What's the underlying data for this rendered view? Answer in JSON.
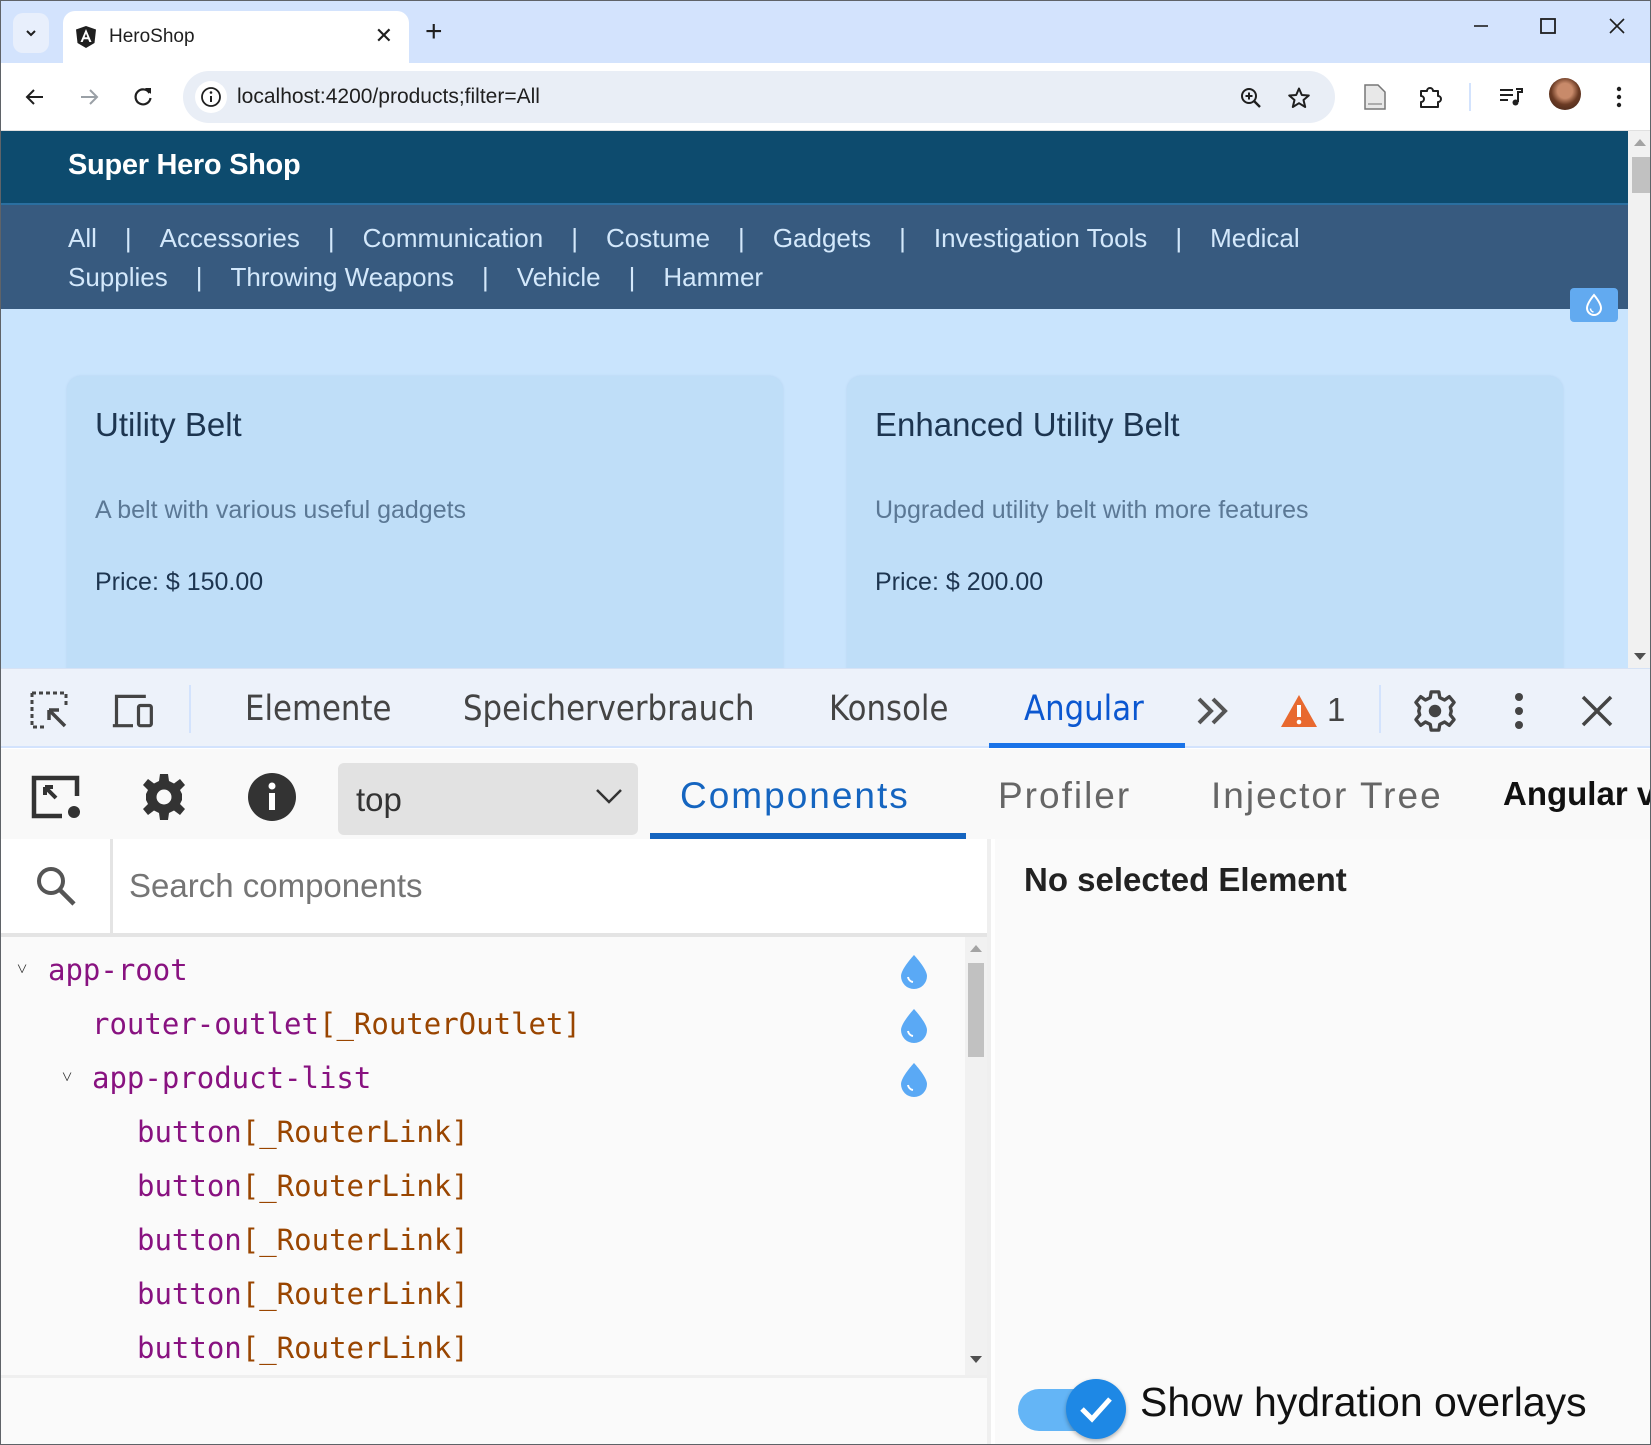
{
  "browser": {
    "tab_title": "HeroShop",
    "url": "localhost:4200/products;filter=All",
    "icons": {
      "tab_search": "chevron-down-icon",
      "favicon": "angular-logo-icon",
      "close_tab": "close-icon",
      "new_tab": "plus-icon",
      "minimize": "minimize-icon",
      "maximize": "maximize-icon",
      "close_window": "close-icon",
      "back": "arrow-left-icon",
      "forward": "arrow-right-icon",
      "reload": "reload-icon",
      "site_info": "info-icon",
      "zoom": "zoom-in-icon",
      "bookmark": "star-icon",
      "reading": "document-icon",
      "extensions": "puzzle-icon",
      "media": "media-control-icon",
      "profile": "avatar",
      "menu": "kebab-menu-icon"
    }
  },
  "page": {
    "site_title": "Super Hero Shop",
    "nav_links": [
      "All",
      "Accessories",
      "Communication",
      "Costume",
      "Gadgets",
      "Investigation Tools",
      "Medical Supplies",
      "Throwing Weapons",
      "Vehicle",
      "Hammer"
    ],
    "nav_separator": "|",
    "products": [
      {
        "name": "Utility Belt",
        "description": "A belt with various useful gadgets",
        "price": "Price: $ 150.00"
      },
      {
        "name": "Enhanced Utility Belt",
        "description": "Upgraded utility belt with more features",
        "price": "Price: $ 200.00"
      }
    ],
    "colors": {
      "header": "#0d4b6e",
      "nav": "#375a7f",
      "background": "#c9e4fd",
      "card": "#bfdef8"
    }
  },
  "devtools": {
    "tabs": [
      {
        "label": "Elemente",
        "active": false
      },
      {
        "label": "Speicherverbrauch",
        "active": false
      },
      {
        "label": "Konsole",
        "active": false
      },
      {
        "label": "Angular",
        "active": true
      }
    ],
    "more_tabs": "»",
    "warning_count": "1",
    "accent": "#1a73e8"
  },
  "angular_devtools": {
    "frame_select": {
      "value": "top"
    },
    "tabs": [
      {
        "label": "Components",
        "active": true
      },
      {
        "label": "Profiler",
        "active": false
      },
      {
        "label": "Injector Tree",
        "active": false
      }
    ],
    "version_label": "Angular v",
    "search": {
      "placeholder": "Search components",
      "value": ""
    },
    "tree": [
      {
        "element": "app-root",
        "directive": "",
        "depth": 0,
        "expandable": true,
        "hydrated": true
      },
      {
        "element": "router-outlet",
        "directive": "[_RouterOutlet]",
        "depth": 1,
        "expandable": false,
        "hydrated": true
      },
      {
        "element": "app-product-list",
        "directive": "",
        "depth": 1,
        "expandable": true,
        "hydrated": true
      },
      {
        "element": "button",
        "directive": "[_RouterLink]",
        "depth": 2,
        "expandable": false,
        "hydrated": false
      },
      {
        "element": "button",
        "directive": "[_RouterLink]",
        "depth": 2,
        "expandable": false,
        "hydrated": false
      },
      {
        "element": "button",
        "directive": "[_RouterLink]",
        "depth": 2,
        "expandable": false,
        "hydrated": false
      },
      {
        "element": "button",
        "directive": "[_RouterLink]",
        "depth": 2,
        "expandable": false,
        "hydrated": false
      },
      {
        "element": "button",
        "directive": "[_RouterLink]",
        "depth": 2,
        "expandable": false,
        "hydrated": false
      }
    ],
    "details": {
      "empty_message": "No selected Element"
    },
    "hydration_toggle": {
      "label": "Show hydration overlays",
      "checked": true
    }
  }
}
